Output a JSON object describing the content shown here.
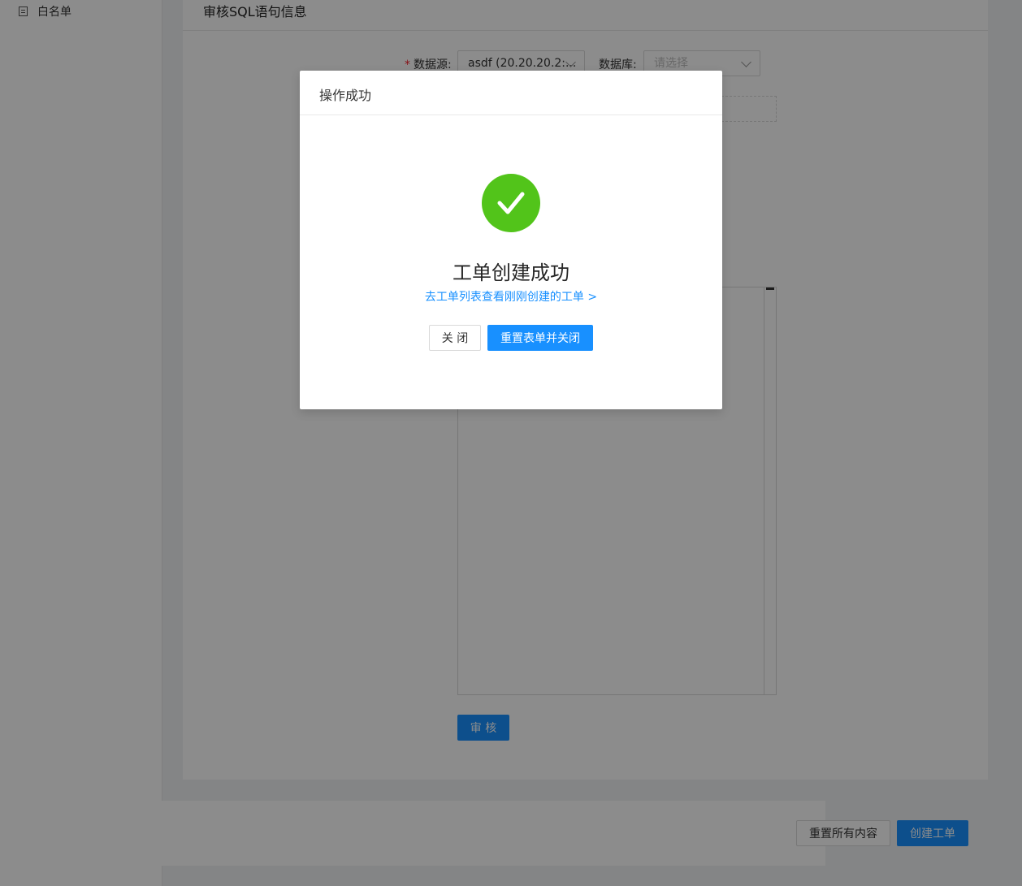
{
  "sidebar": {
    "items": [
      {
        "label": "白名单",
        "icon": "list-icon"
      }
    ]
  },
  "card": {
    "title": "审核SQL语句信息"
  },
  "form": {
    "datasource_label": "数据源:",
    "datasource_value": "asdf (20.20.20.2:...",
    "database_label": "数据库:",
    "database_placeholder": "请选择",
    "audit_button": "审 核"
  },
  "footer": {
    "reset_all_button": "重置所有内容",
    "create_button": "创建工单"
  },
  "modal": {
    "title": "操作成功",
    "result_title": "工单创建成功",
    "result_link": "去工单列表查看刚刚创建的工单 >",
    "close_button": "关 闭",
    "reset_close_button": "重置表单并关闭",
    "icon": "check-circle-icon",
    "success_color": "#52c41a",
    "primary_color": "#1890ff"
  }
}
